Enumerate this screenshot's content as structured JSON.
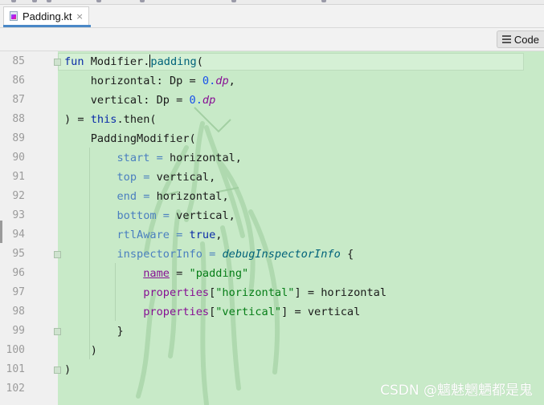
{
  "tab": {
    "label": "Padding.kt",
    "close": "×"
  },
  "toolbar": {
    "code_label": "Code"
  },
  "editor": {
    "lines": [
      {
        "num": "85"
      },
      {
        "num": "86"
      },
      {
        "num": "87"
      },
      {
        "num": "88"
      },
      {
        "num": "89"
      },
      {
        "num": "90"
      },
      {
        "num": "91"
      },
      {
        "num": "92"
      },
      {
        "num": "93"
      },
      {
        "num": "94"
      },
      {
        "num": "95"
      },
      {
        "num": "96"
      },
      {
        "num": "97"
      },
      {
        "num": "98"
      },
      {
        "num": "99"
      },
      {
        "num": "100"
      },
      {
        "num": "101"
      },
      {
        "num": "102"
      }
    ],
    "code": {
      "l85": {
        "kw": "fun",
        "recv": "Modifier.",
        "name": "padding",
        "rest": "("
      },
      "l86": {
        "a": "horizontal: Dp = ",
        "num": "0.",
        "unit": "dp",
        "end": ","
      },
      "l87": {
        "a": "vertical: Dp = ",
        "num": "0.",
        "unit": "dp"
      },
      "l88": {
        "a": ") = ",
        "kw": "this",
        "b": ".then("
      },
      "l89": {
        "a": "PaddingModifier("
      },
      "l90": {
        "p": "start",
        "eq": " = ",
        "v": "horizontal,"
      },
      "l91": {
        "p": "top",
        "eq": " = ",
        "v": "vertical,"
      },
      "l92": {
        "p": "end",
        "eq": " = ",
        "v": "horizontal,"
      },
      "l93": {
        "p": "bottom",
        "eq": " = ",
        "v": "vertical,"
      },
      "l94": {
        "p": "rtlAware",
        "eq": " = ",
        "kw": "true",
        "v": ","
      },
      "l95": {
        "p": "inspectorInfo",
        "eq": " = ",
        "fn": "debugInspectorInfo",
        "v": " {"
      },
      "l96": {
        "name": "name",
        "eq": " = ",
        "str": "\"padding\""
      },
      "l97": {
        "prop": "properties",
        "a": "[",
        "str": "\"horizontal\"",
        "b": "] = horizontal"
      },
      "l98": {
        "prop": "properties",
        "a": "[",
        "str": "\"vertical\"",
        "b": "] = vertical"
      },
      "l99": {
        "a": "}"
      },
      "l100": {
        "a": ")"
      },
      "l101": {
        "a": ")"
      }
    }
  },
  "watermark": "CSDN @魑魅魍魉都是鬼",
  "colors": {
    "editor_bg": "#c8eac8",
    "keyword": "#0a2ba8",
    "string": "#067d17",
    "number": "#1750eb",
    "param": "#4a7fbf"
  }
}
